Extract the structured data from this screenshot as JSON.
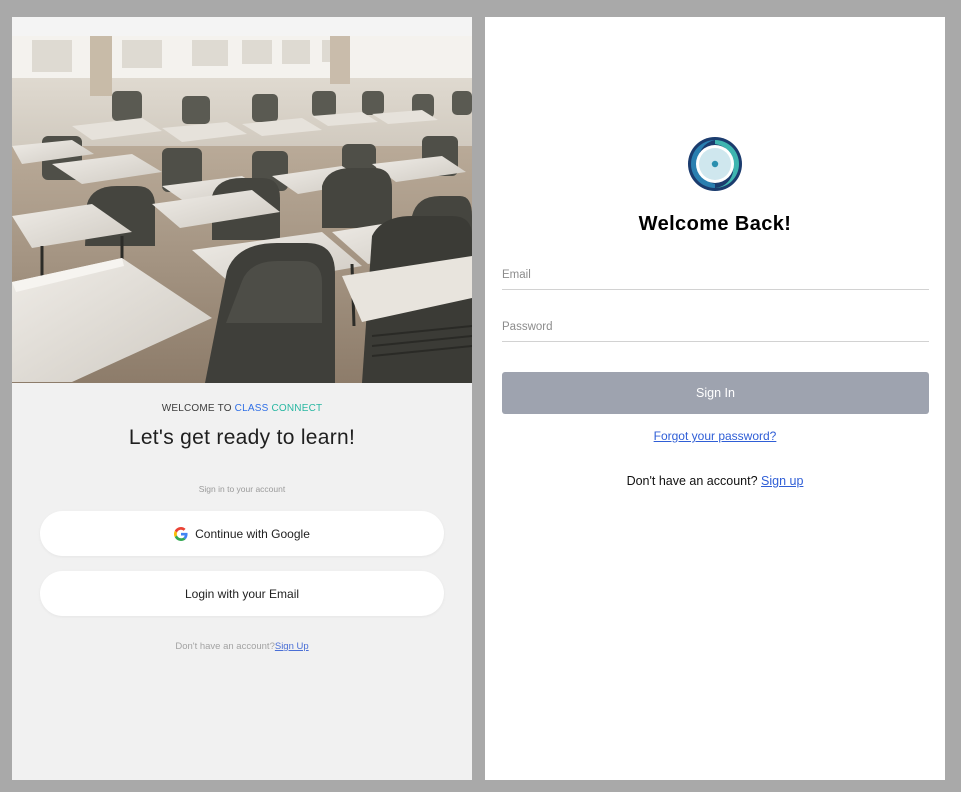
{
  "left": {
    "welcome_prefix": "WELCOME TO",
    "brand_class": "CLASS",
    "brand_connect": "CONNECT",
    "title": "Let's get ready to learn!",
    "subtitle": "Sign in to your account",
    "google_button_label": "Continue with Google",
    "email_button_label": "Login with your Email",
    "signup_prompt": "Don't have an account?",
    "signup_link": "Sign Up",
    "hero_image": "classroom-photo"
  },
  "right": {
    "logo": "class-connect-logo",
    "title": "Welcome Back!",
    "email_placeholder": "Email",
    "password_placeholder": "Password",
    "signin_button_label": "Sign In",
    "forgot_link": "Forgot your password?",
    "signup_prompt": "Don't have an account?",
    "signup_link": "Sign up"
  },
  "colors": {
    "brand_blue": "#2f6fe6",
    "brand_teal": "#28b7a2",
    "link_blue": "#2f5ed6",
    "signin_button_bg": "#9ea3af",
    "logo_navy": "#1b3c6e",
    "logo_teal": "#3fb5b0"
  }
}
